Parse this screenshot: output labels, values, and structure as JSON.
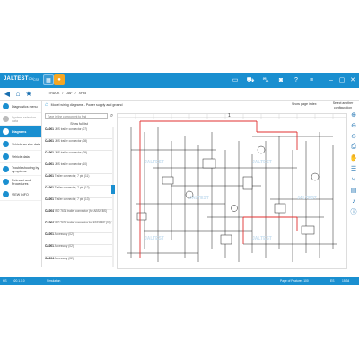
{
  "app": {
    "logo": "JALTEST",
    "logo_sub": "CV",
    "extension": "CSP",
    "status_left_a": "HS",
    "status_left_b": "v20.1.1.0",
    "status_mode": "Simulation",
    "status_pages": "Page of Features 100",
    "status_right_a": "ES",
    "status_time": "15:34"
  },
  "toolbar": {
    "back_icon": "arrow-left-icon",
    "home_icon": "home-icon",
    "favorite_icon": "star-icon"
  },
  "breadcrumb": [
    "TRUCK",
    "DAF",
    "XF95"
  ],
  "sidebar": {
    "items": [
      {
        "label": "Diagnostics menu",
        "state": "normal"
      },
      {
        "label": "System selection data",
        "state": "dim"
      },
      {
        "label": "Diagrams",
        "state": "active"
      },
      {
        "label": "Vehicle service data",
        "state": "normal"
      },
      {
        "label": "Vehicle data",
        "state": "normal"
      },
      {
        "label": "Troubleshooting by symptoms",
        "state": "normal"
      },
      {
        "label": "Relevant and Procedures",
        "state": "normal"
      },
      {
        "label": "VIEW INFO",
        "state": "normal"
      }
    ]
  },
  "document": {
    "title": "Model wiring diagrams - Power supply and ground",
    "show_page_index": "Show page index",
    "select_config": "Select another configuration",
    "page_number": "1"
  },
  "components": {
    "search_placeholder": "Type in the component to find",
    "show_full_list": "Show full list",
    "items": [
      {
        "code": "CA001",
        "desc": "JHS trailer connector (07)"
      },
      {
        "code": "CA001",
        "desc": "JHS trailer connector (08)"
      },
      {
        "code": "CA001",
        "desc": "JHS trailer connector (09)"
      },
      {
        "code": "CA001",
        "desc": "JHS trailer connector (10)"
      },
      {
        "code": "CA001",
        "desc": "Trailer connector, 7 pin (11)"
      },
      {
        "code": "CA001",
        "desc": "Trailer connector, 7 pin (12)"
      },
      {
        "code": "CA001",
        "desc": "Trailer connector, 7 pin (13)"
      },
      {
        "code": "CA004",
        "desc": "ISO 7638 trailer connector (for ABS/EBS)"
      },
      {
        "code": "CA004",
        "desc": "ISO 7638 trailer connector for ABS/EBS (02)"
      },
      {
        "code": "CA001",
        "desc": "Accessory (02)"
      },
      {
        "code": "CA001",
        "desc": "Accessory (02)"
      },
      {
        "code": "CA004",
        "desc": "Accessory (02)"
      },
      {
        "code": "CA004",
        "desc": "Accessory 7 pin (02)"
      }
    ]
  },
  "colors": {
    "primary": "#1a8fd0",
    "accent": "#f5a623",
    "wire_red": "#e03030"
  }
}
